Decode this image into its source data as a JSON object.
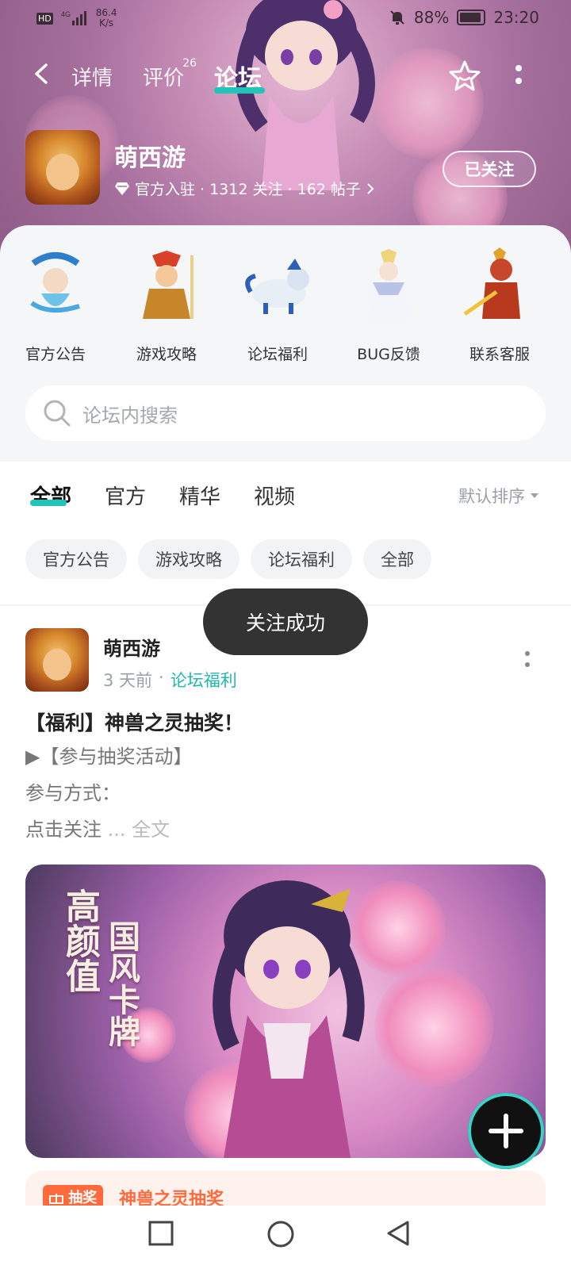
{
  "status_bar": {
    "hd": "HD",
    "net_speed_value": "86.4",
    "net_speed_unit": "K/s",
    "battery": "88%",
    "time": "23:20"
  },
  "nav": {
    "tabs": [
      {
        "label": "详情"
      },
      {
        "label": "评价",
        "badge": "26"
      },
      {
        "label": "论坛"
      }
    ],
    "active_tab": "论坛"
  },
  "game": {
    "name": "萌西游",
    "meta_official": "官方入驻",
    "meta_stats": "· 1312 关注 · 162 帖子",
    "follow_label": "已关注"
  },
  "categories": [
    {
      "label": "官方公告",
      "icon": "scythe-hero-icon"
    },
    {
      "label": "游戏攻略",
      "icon": "warrior-hero-icon"
    },
    {
      "label": "论坛福利",
      "icon": "beast-icon"
    },
    {
      "label": "BUG反馈",
      "icon": "white-sage-icon"
    },
    {
      "label": "联系客服",
      "icon": "red-demon-icon"
    }
  ],
  "search": {
    "placeholder": "论坛内搜索"
  },
  "filters": {
    "tabs": [
      "全部",
      "官方",
      "精华",
      "视频"
    ],
    "active": "全部",
    "sort_label": "默认排序"
  },
  "chips": [
    "官方公告",
    "游戏攻略",
    "论坛福利",
    "全部"
  ],
  "toast": "关注成功",
  "post": {
    "author": "萌西游",
    "time": "3 天前",
    "tag": "论坛福利",
    "title": "【福利】神兽之灵抽奖！",
    "line1": "▶【参与抽奖活动】",
    "line2": "参与方式：",
    "line3": "点击关注",
    "more": "... 全文",
    "banner_text_1": "高颜值",
    "banner_text_2": "国风卡牌",
    "lottery_badge": "抽奖",
    "lottery_title": "神兽之灵抽奖"
  },
  "colors": {
    "accent": "#22c3b8",
    "lottery": "#ff6a3d"
  }
}
